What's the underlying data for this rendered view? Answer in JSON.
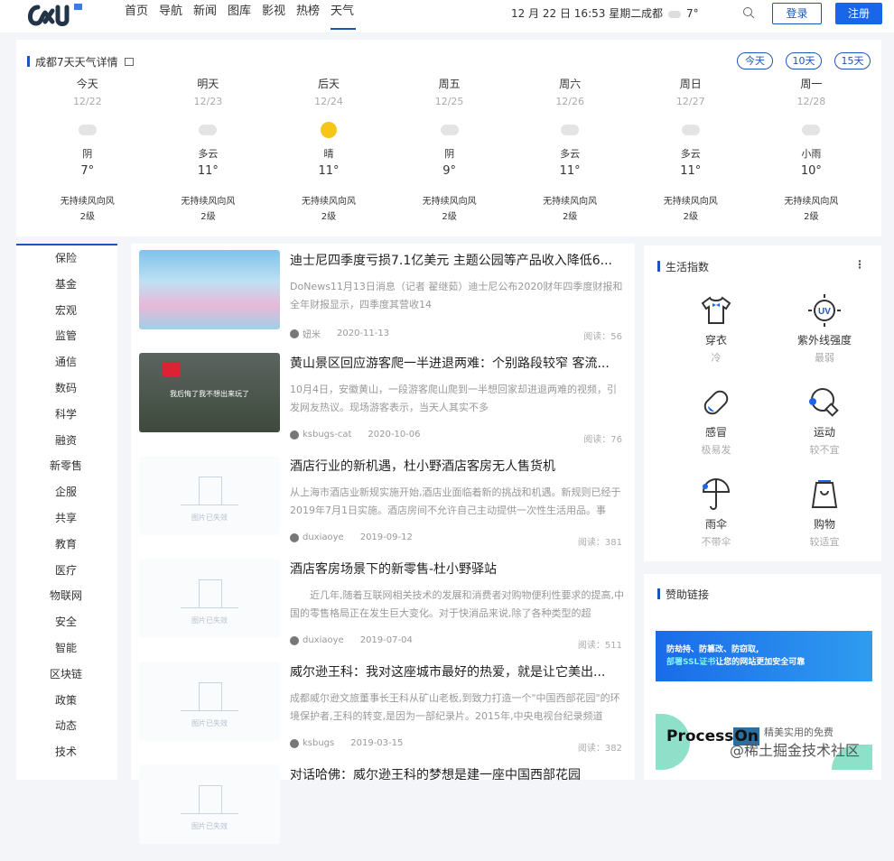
{
  "header": {
    "logo_badge": "CM",
    "nav": [
      "首页",
      "导航",
      "新闻",
      "图库",
      "影视",
      "热榜",
      "天气"
    ],
    "active_nav": "天气",
    "datetime": "12 月 22 日 16:53 星期二",
    "city": "成都",
    "city_temp": "7°",
    "login": "登录",
    "register": "注册"
  },
  "weather": {
    "title": "成都7天天气详情",
    "ranges": [
      "今天",
      "10天",
      "15天"
    ],
    "days": [
      {
        "name": "今天",
        "date": "12/22",
        "cond": "阴",
        "icon": "cloud",
        "temp": "7°",
        "wind": "无持续风向风",
        "level": "2级"
      },
      {
        "name": "明天",
        "date": "12/23",
        "cond": "多云",
        "icon": "cloud",
        "temp": "11°",
        "wind": "无持续风向风",
        "level": "2级"
      },
      {
        "name": "后天",
        "date": "12/24",
        "cond": "晴",
        "icon": "sun",
        "temp": "11°",
        "wind": "无持续风向风",
        "level": "2级"
      },
      {
        "name": "周五",
        "date": "12/25",
        "cond": "阴",
        "icon": "cloud",
        "temp": "9°",
        "wind": "无持续风向风",
        "level": "2级"
      },
      {
        "name": "周六",
        "date": "12/26",
        "cond": "多云",
        "icon": "cloud",
        "temp": "11°",
        "wind": "无持续风向风",
        "level": "2级"
      },
      {
        "name": "周日",
        "date": "12/27",
        "cond": "多云",
        "icon": "cloud",
        "temp": "11°",
        "wind": "无持续风向风",
        "level": "2级"
      },
      {
        "name": "周一",
        "date": "12/28",
        "cond": "小雨",
        "icon": "rain",
        "temp": "10°",
        "wind": "无持续风向风",
        "level": "2级"
      }
    ]
  },
  "categories": [
    "保险",
    "基金",
    "宏观",
    "监管",
    "通信",
    "数码",
    "科学",
    "融资",
    "新零售",
    "企服",
    "共享",
    "教育",
    "医疗",
    "物联网",
    "安全",
    "智能",
    "区块链",
    "政策",
    "动态",
    "技术"
  ],
  "articles": [
    {
      "title": "迪士尼四季度亏损7.1亿美元 主题公园等产品收入降低6...",
      "desc": "DoNews11月13日消息（记者 翟继茹）迪士尼公布2020财年四季度财报和全年财报显示，四季度其营收14",
      "author": "妞米",
      "date": "2020-11-13",
      "reads": "阅读：56",
      "thumb": "disney"
    },
    {
      "title": "黄山景区回应游客爬一半进退两难：个别路段较窄 客流...",
      "desc": "10月4日，安徽黄山，一段游客爬山爬到一半想回家却进退两难的视频，引发网友热议。现场游客表示，当天人其实不多",
      "author": "ksbugs-cat",
      "date": "2020-10-06",
      "reads": "阅读：76",
      "thumb": "video",
      "thumb_caption": "我后悔了我不想出来玩了"
    },
    {
      "title": "酒店行业的新机遇，杜小野酒店客房无人售货机",
      "desc": "从上海市酒店业新规实施开始,酒店业面临着新的挑战和机遇。新规则已经于2019年7月1日实施。酒店房间不允许自己主动提供一次性生活用品。事",
      "author": "duxiaoye",
      "date": "2019-09-12",
      "reads": "阅读：381",
      "thumb": "missing"
    },
    {
      "title": "酒店客房场景下的新零售-杜小野驿站",
      "desc": "　　近几年,随着互联网相关技术的发展和消费者对购物便利性要求的提高,中国的零售格局正在发生巨大变化。对于快消品来说,除了各种类型的超",
      "author": "duxiaoye",
      "date": "2019-07-04",
      "reads": "阅读：511",
      "thumb": "missing"
    },
    {
      "title": "威尔逊王科：我对这座城市最好的热爱，就是让它美出...",
      "desc": "成都威尔逊文旅董事长王科从矿山老板,到致力打造一个\"中国西部花园\"的环境保护者,王科的转变,是因为一部纪录片。2015年,中央电视台纪录频道",
      "author": "ksbugs",
      "date": "2019-03-15",
      "reads": "阅读：382",
      "thumb": "missing"
    },
    {
      "title": "对话哈佛：威尔逊王科的梦想是建一座中国西部花园",
      "desc": "",
      "author": "",
      "date": "",
      "reads": "",
      "thumb": "missing"
    }
  ],
  "missing_image_text": "图片已失效",
  "life": {
    "title": "生活指数",
    "items": [
      {
        "name": "穿衣",
        "value": "冷",
        "icon": "shirt"
      },
      {
        "name": "紫外线强度",
        "value": "最弱",
        "icon": "uv"
      },
      {
        "name": "感冒",
        "value": "极易发",
        "icon": "pill"
      },
      {
        "name": "运动",
        "value": "较不宜",
        "icon": "pingpong"
      },
      {
        "name": "雨伞",
        "value": "不带伞",
        "icon": "umbrella"
      },
      {
        "name": "购物",
        "value": "较适宜",
        "icon": "bag"
      }
    ]
  },
  "sponsor": {
    "title": "赞助链接",
    "ad1_line1": "防劫持、防篡改、防窃取,",
    "ad1_ssl": "部署SSL证书",
    "ad1_line2": "让您的网站更加安全可靠",
    "ad2_brand": "Process",
    "ad2_on": "On",
    "ad2_tag": "精美实用的免费"
  },
  "watermark": "@稀土掘金技术社区",
  "colors": {
    "accent": "#1c55b8",
    "register": "#1a66e8",
    "sun": "#f5c518"
  }
}
